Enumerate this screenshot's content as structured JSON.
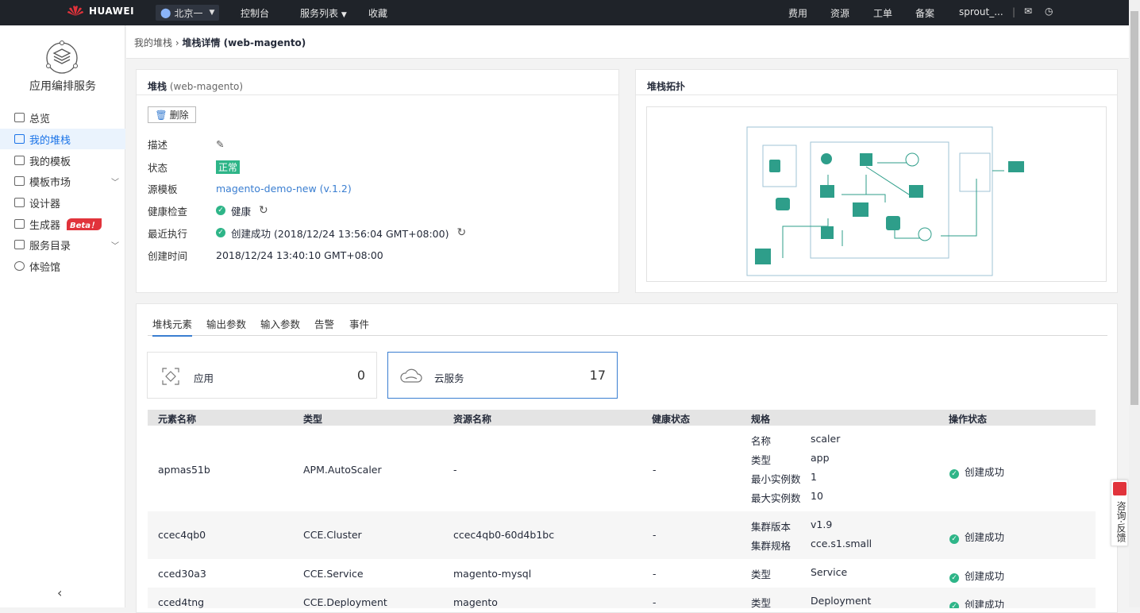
{
  "topbar": {
    "brand": "HUAWEI",
    "region": "北京一",
    "nav": [
      "控制台",
      "服务列表",
      "收藏"
    ],
    "right": [
      "费用",
      "资源",
      "工单",
      "备案",
      "sprout_..."
    ]
  },
  "sidebar": {
    "service_title": "应用编排服务",
    "items": [
      {
        "label": "总览",
        "icon": "chart-icon"
      },
      {
        "label": "我的堆栈",
        "icon": "stack-icon"
      },
      {
        "label": "我的模板",
        "icon": "template-icon"
      },
      {
        "label": "模板市场",
        "icon": "market-icon"
      },
      {
        "label": "设计器",
        "icon": "designer-icon"
      },
      {
        "label": "生成器",
        "icon": "generator-icon"
      },
      {
        "label": "服务目录",
        "icon": "catalog-icon"
      },
      {
        "label": "体验馆",
        "icon": "experience-icon"
      }
    ],
    "beta": "Beta！"
  },
  "breadcrumb": {
    "parent": "我的堆栈",
    "current": "堆栈详情 (web-magento)"
  },
  "stack": {
    "title": "堆栈",
    "name": "(web-magento)",
    "delete_label": "删除",
    "fields": {
      "desc_label": "描述",
      "status_label": "状态",
      "status": "正常",
      "source_label": "源模板",
      "source": "magento-demo-new (v.1.2)",
      "health_label": "健康检查",
      "health": "健康",
      "last_label": "最近执行",
      "last": "创建成功 (2018/12/24 13:56:04 GMT+08:00)",
      "created_label": "创建时间",
      "created": "2018/12/24 13:40:10 GMT+08:00"
    }
  },
  "topology": {
    "title": "堆栈拓扑"
  },
  "tabs": [
    "堆栈元素",
    "输出参数",
    "输入参数",
    "告警",
    "事件"
  ],
  "stats": [
    {
      "label": "应用",
      "value": "0"
    },
    {
      "label": "云服务",
      "value": "17"
    }
  ],
  "table": {
    "headers": [
      "元素名称",
      "类型",
      "资源名称",
      "健康状态",
      "规格",
      "操作状态"
    ],
    "rows": [
      {
        "name": "apmas51b",
        "type": "APM.AutoScaler",
        "resource": "-",
        "health": "-",
        "spec": [
          [
            "名称",
            "scaler"
          ],
          [
            "类型",
            "app"
          ],
          [
            "最小实例数",
            "1"
          ],
          [
            "最大实例数",
            "10"
          ]
        ],
        "op": "创建成功"
      },
      {
        "name": "ccec4qb0",
        "type": "CCE.Cluster",
        "resource": "ccec4qb0-60d4b1bc",
        "health": "-",
        "spec": [
          [
            "集群版本",
            "v1.9"
          ],
          [
            "集群规格",
            "cce.s1.small"
          ]
        ],
        "op": "创建成功"
      },
      {
        "name": "cced30a3",
        "type": "CCE.Service",
        "resource": "magento-mysql",
        "health": "-",
        "spec": [
          [
            "类型",
            "Service"
          ]
        ],
        "op": "创建成功"
      },
      {
        "name": "cced4tng",
        "type": "CCE.Deployment",
        "resource": "magento",
        "health": "-",
        "spec": [
          [
            "类型",
            "Deployment"
          ]
        ],
        "op": "创建成功"
      }
    ]
  },
  "consult": "咨询·反馈"
}
